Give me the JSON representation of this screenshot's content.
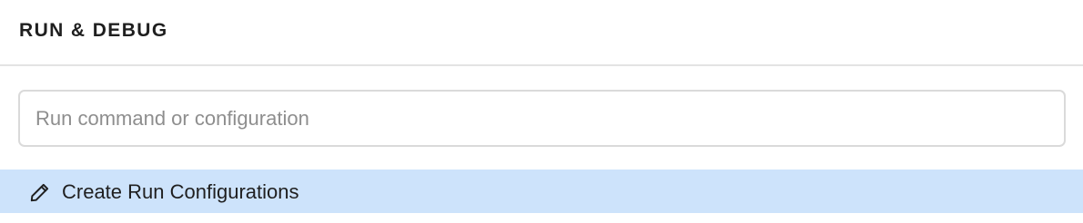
{
  "header": {
    "title": "RUN & DEBUG"
  },
  "search": {
    "value": "",
    "placeholder": "Run command or configuration"
  },
  "results": {
    "items": [
      {
        "label": "Create Run Configurations",
        "icon": "pencil-icon",
        "selected": true
      }
    ]
  },
  "colors": {
    "selected_background": "#cde3fb",
    "text": "#1f1f1f",
    "placeholder": "#8e8e8e",
    "border": "#dadada"
  }
}
